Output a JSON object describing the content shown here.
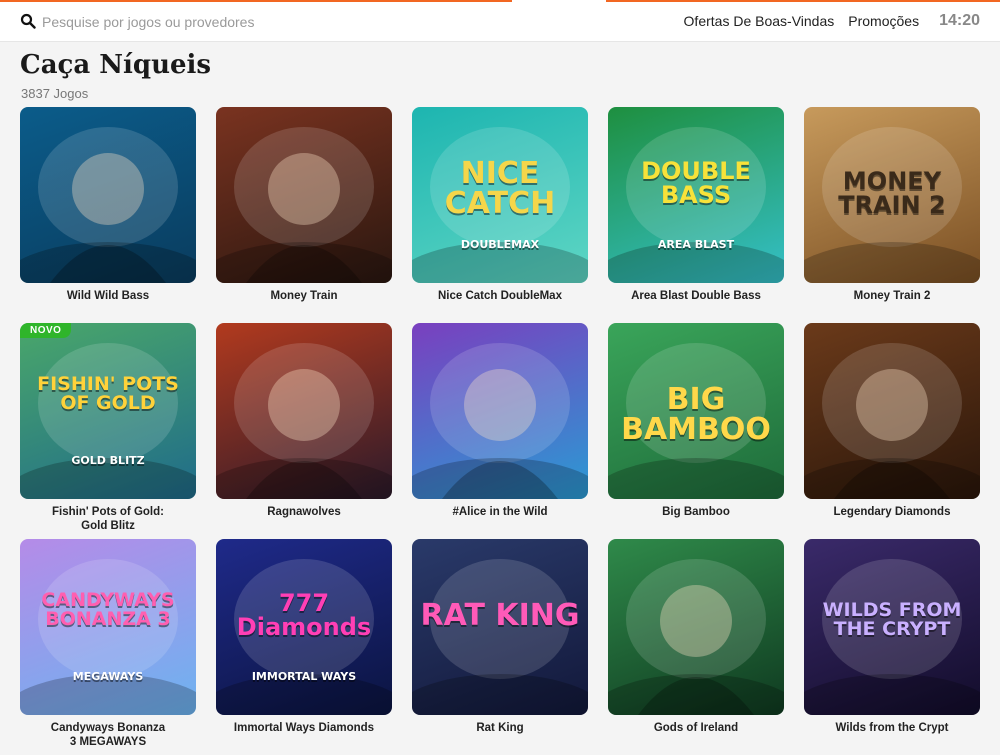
{
  "header": {
    "search_placeholder": "Pesquise por jogos ou provedores",
    "nav": [
      "Ofertas De Boas-Vindas",
      "Promoções"
    ],
    "clock": "14:20"
  },
  "page": {
    "title": "Caça Níqueis",
    "count": "3837 Jogos"
  },
  "games": [
    {
      "title": "Wild Wild Bass",
      "logo": "",
      "bg": [
        "#0b5c8a",
        "#0a3c5e"
      ],
      "logo_color": "#ffffff"
    },
    {
      "title": "Money Train",
      "logo": "",
      "bg": [
        "#7a3320",
        "#2a1710"
      ],
      "logo_color": "#ffffff"
    },
    {
      "title": "Nice Catch DoubleMax",
      "logo": "NICE CATCH",
      "sub": "DOUBLEMAX",
      "bg": [
        "#1db5b0",
        "#5fd6c4"
      ],
      "logo_color": "#f5d64a"
    },
    {
      "title": "Area Blast Double Bass",
      "logo": "DOUBLE BASS",
      "sub": "AREA BLAST",
      "bg": [
        "#1e8f3f",
        "#35c0c9"
      ],
      "logo_color": "#f7e23a"
    },
    {
      "title": "Money Train 2",
      "logo": "MONEY TRAIN 2",
      "bg": [
        "#c79a5c",
        "#7a4f23"
      ],
      "logo_color": "#3a2a1a"
    },
    {
      "title": "Fishin' Pots of Gold: Gold Blitz",
      "logo": "FISHIN' POTS OF GOLD",
      "sub": "GOLD BLITZ",
      "bg": [
        "#4aa76a",
        "#1f6b8a"
      ],
      "logo_color": "#ffd23a",
      "badge": "NOVO"
    },
    {
      "title": "Ragnawolves",
      "logo": "",
      "bg": [
        "#b23a1e",
        "#2b1a2a"
      ],
      "logo_color": "#ffffff"
    },
    {
      "title": "#Alice in the Wild",
      "logo": "",
      "bg": [
        "#7a3fbf",
        "#2a9bd4"
      ],
      "logo_color": "#ffffff"
    },
    {
      "title": "Big Bamboo",
      "logo": "BIG BAMBOO",
      "bg": [
        "#3aa55a",
        "#1e6b3a"
      ],
      "logo_color": "#ffd84a"
    },
    {
      "title": "Legendary Diamonds",
      "logo": "",
      "bg": [
        "#6b3a1a",
        "#2a160a"
      ],
      "logo_color": "#ffffff"
    },
    {
      "title": "Candyways Bonanza 3 MEGAWAYS",
      "logo": "CANDYWAYS BONANZA 3",
      "sub": "MEGAWAYS",
      "bg": [
        "#b58be8",
        "#6cb3f0"
      ],
      "logo_color": "#ff5fb0"
    },
    {
      "title": "Immortal Ways Diamonds",
      "logo": "777 Diamonds",
      "sub": "IMMORTAL WAYS",
      "bg": [
        "#1f2a8a",
        "#0b1440"
      ],
      "logo_color": "#ff3fb5"
    },
    {
      "title": "Rat King",
      "logo": "RAT KING",
      "bg": [
        "#2a3a6a",
        "#12183a"
      ],
      "logo_color": "#ff5ab8"
    },
    {
      "title": "Gods of Ireland",
      "logo": "",
      "bg": [
        "#2f8a4a",
        "#0f3a20"
      ],
      "logo_color": "#ffffff"
    },
    {
      "title": "Wilds from the Crypt",
      "logo": "WILDS FROM THE CRYPT",
      "bg": [
        "#3a2a6a",
        "#120c2a"
      ],
      "logo_color": "#c9b0ff"
    }
  ],
  "colors": {
    "accent": "#f26722",
    "badge_new": "#2fb52a"
  }
}
